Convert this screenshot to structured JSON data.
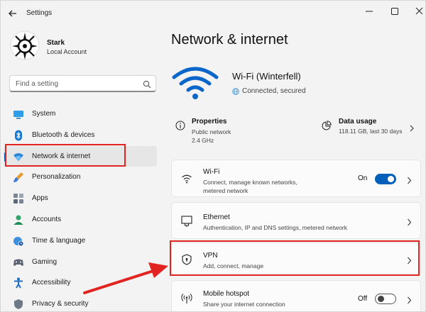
{
  "window": {
    "title": "Settings"
  },
  "user": {
    "name": "Stark",
    "account_type": "Local Account"
  },
  "search": {
    "placeholder": "Find a setting"
  },
  "sidebar": {
    "items": [
      {
        "label": "System",
        "icon": "monitor-icon"
      },
      {
        "label": "Bluetooth & devices",
        "icon": "bluetooth-icon"
      },
      {
        "label": "Network & internet",
        "icon": "wifi-icon",
        "active": true
      },
      {
        "label": "Personalization",
        "icon": "brush-icon"
      },
      {
        "label": "Apps",
        "icon": "apps-icon"
      },
      {
        "label": "Accounts",
        "icon": "accounts-icon"
      },
      {
        "label": "Time & language",
        "icon": "globe-clock-icon"
      },
      {
        "label": "Gaming",
        "icon": "gamepad-icon"
      },
      {
        "label": "Accessibility",
        "icon": "accessibility-icon"
      },
      {
        "label": "Privacy & security",
        "icon": "shield-icon"
      }
    ]
  },
  "main": {
    "title": "Network & internet",
    "connection": {
      "name": "Wi-Fi (Winterfell)",
      "status": "Connected, secured"
    },
    "properties": {
      "title": "Properties",
      "line1": "Public network",
      "line2": "2.4 GHz"
    },
    "data_usage": {
      "title": "Data usage",
      "detail": "118.11 GB, last 30 days"
    },
    "cards": {
      "wifi": {
        "title": "Wi-Fi",
        "desc_line1": "Connect, manage known networks,",
        "desc_line2": "metered network",
        "toggle_label": "On",
        "toggle_on": true
      },
      "ethernet": {
        "title": "Ethernet",
        "desc": "Authentication, IP and DNS settings, metered network"
      },
      "vpn": {
        "title": "VPN",
        "desc": "Add, connect, manage"
      },
      "hotspot": {
        "title": "Mobile hotspot",
        "desc": "Share your internet connection",
        "toggle_label": "Off",
        "toggle_on": false
      }
    }
  },
  "colors": {
    "accent": "#005fb8",
    "highlight_red": "#e1241f",
    "background": "#f3f3f3",
    "card": "#fbfbfb"
  }
}
